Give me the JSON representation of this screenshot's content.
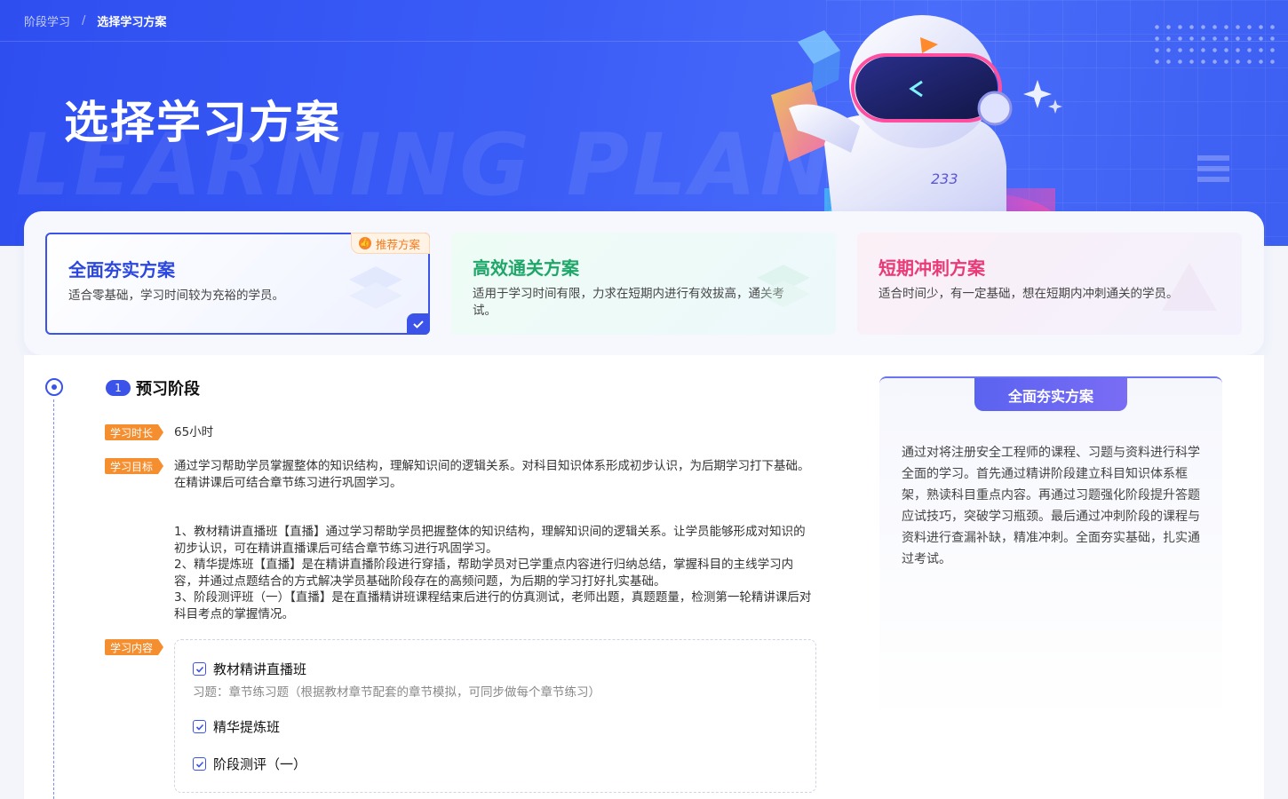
{
  "breadcrumb": {
    "parent": "阶段学习",
    "separator": "/",
    "current": "选择学习方案"
  },
  "banner": {
    "title": "选择学习方案",
    "watermark": "LEARNING PLAN",
    "mascot_badge": "233"
  },
  "plans": [
    {
      "title": "全面夯实方案",
      "desc": "适合零基础，学习时间较为充裕的学员。",
      "recommend": "推荐方案",
      "selected": true
    },
    {
      "title": "高效通关方案",
      "desc": "适用于学习时间有限，力求在短期内进行有效拔高，通关考试。",
      "selected": false
    },
    {
      "title": "短期冲刺方案",
      "desc": "适合时间少，有一定基础，想在短期内冲刺通关的学员。",
      "selected": false
    }
  ],
  "stage": {
    "number": "1",
    "title": "预习阶段",
    "duration_label": "学习时长",
    "duration": "65小时",
    "goal_label": "学习目标",
    "goal": "通过学习帮助学员掌握整体的知识结构，理解知识间的逻辑关系。对科目知识体系形成初步认识，为后期学习打下基础。在精讲课后可结合章节练习进行巩固学习。",
    "details": [
      "1、教材精讲直播班【直播】通过学习帮助学员把握整体的知识结构，理解知识间的逻辑关系。让学员能够形成对知识的初步认识，可在精讲直播课后可结合章节练习进行巩固学习。",
      "2、精华提炼班【直播】是在精讲直播阶段进行穿插，帮助学员对已学重点内容进行归纳总结，掌握科目的主线学习内容，并通过点题结合的方式解决学员基础阶段存在的高频问题，为后期的学习打好扎实基础。",
      "3、阶段测评班（一）【直播】是在直播精讲班课程结束后进行的仿真测试，老师出题，真题题量，检测第一轮精讲课后对科目考点的掌握情况。"
    ],
    "content_label": "学习内容",
    "content_items": [
      {
        "name": "教材精讲直播班",
        "sub": "习题：章节练习题（根据教材章节配套的章节模拟，可同步做每个章节练习）"
      },
      {
        "name": "精华提炼班"
      },
      {
        "name": "阶段测评（一）"
      }
    ]
  },
  "summary": {
    "title": "全面夯实方案",
    "text": "通过对将注册安全工程师的课程、习题与资料进行科学全面的学习。首先通过精讲阶段建立科目知识体系框架，熟读科目重点内容。再通过习题强化阶段提升答题应试技巧，突破学习瓶颈。最后通过冲刺阶段的课程与资料进行查漏补缺，精准冲刺。全面夯实基础，扎实通过考试。"
  },
  "colors": {
    "primary": "#3b53e8",
    "orange": "#f58e2e",
    "green": "#1fa769",
    "pink": "#e83a76"
  }
}
